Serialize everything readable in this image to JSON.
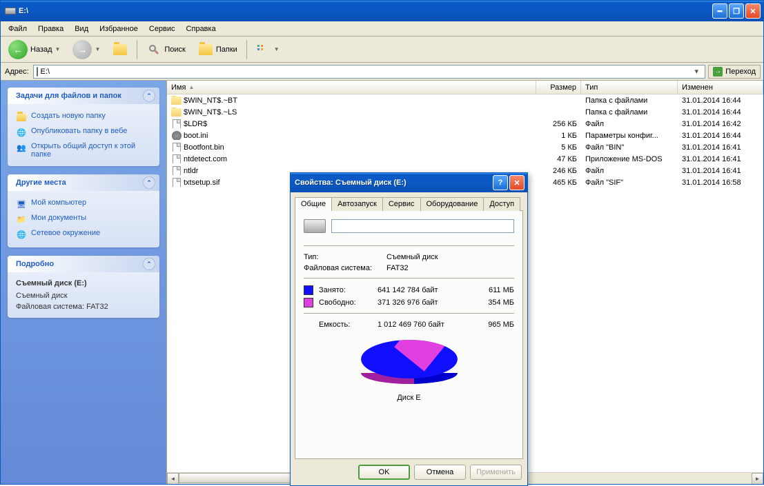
{
  "window": {
    "title": "E:\\",
    "menu": [
      "Файл",
      "Правка",
      "Вид",
      "Избранное",
      "Сервис",
      "Справка"
    ],
    "toolbar": {
      "back": "Назад",
      "search": "Поиск",
      "folders": "Папки"
    },
    "address": {
      "label": "Адрес:",
      "value": "E:\\",
      "go": "Переход"
    }
  },
  "sidebar": {
    "tasks": {
      "title": "Задачи для файлов и папок",
      "items": [
        "Создать новую папку",
        "Опубликовать папку в вебе",
        "Открыть общий доступ к этой папке"
      ]
    },
    "places": {
      "title": "Другие места",
      "items": [
        "Мой компьютер",
        "Мои документы",
        "Сетевое окружение"
      ]
    },
    "details": {
      "title": "Подробно",
      "name": "Съемный диск (E:)",
      "type": "Съемный диск",
      "fs": "Файловая система: FAT32"
    }
  },
  "columns": {
    "name": "Имя",
    "size": "Размер",
    "type": "Тип",
    "modified": "Изменен"
  },
  "files": [
    {
      "icon": "folder",
      "name": "$WIN_NT$.~BT",
      "size": "",
      "type": "Папка с файлами",
      "mod": "31.01.2014 16:44"
    },
    {
      "icon": "folder",
      "name": "$WIN_NT$.~LS",
      "size": "",
      "type": "Папка с файлами",
      "mod": "31.01.2014 16:44"
    },
    {
      "icon": "file",
      "name": "$LDR$",
      "size": "256 КБ",
      "type": "Файл",
      "mod": "31.01.2014 16:42"
    },
    {
      "icon": "gear",
      "name": "boot.ini",
      "size": "1 КБ",
      "type": "Параметры конфиг...",
      "mod": "31.01.2014 16:44"
    },
    {
      "icon": "file",
      "name": "Bootfont.bin",
      "size": "5 КБ",
      "type": "Файл \"BIN\"",
      "mod": "31.01.2014 16:41"
    },
    {
      "icon": "file",
      "name": "ntdetect.com",
      "size": "47 КБ",
      "type": "Приложение MS-DOS",
      "mod": "31.01.2014 16:41"
    },
    {
      "icon": "file",
      "name": "ntldr",
      "size": "246 КБ",
      "type": "Файл",
      "mod": "31.01.2014 16:41"
    },
    {
      "icon": "file",
      "name": "txtsetup.sif",
      "size": "465 КБ",
      "type": "Файл \"SIF\"",
      "mod": "31.01.2014 16:58"
    }
  ],
  "dialog": {
    "title": "Свойства: Съемный диск (E:)",
    "tabs": [
      "Общие",
      "Автозапуск",
      "Сервис",
      "Оборудование",
      "Доступ"
    ],
    "name_value": "",
    "type_label": "Тип:",
    "type_value": "Съемный диск",
    "fs_label": "Файловая система:",
    "fs_value": "FAT32",
    "used_label": "Занято:",
    "used_bytes": "641 142 784 байт",
    "used_mb": "611 МБ",
    "free_label": "Свободно:",
    "free_bytes": "371 326 976 байт",
    "free_mb": "354 МБ",
    "cap_label": "Емкость:",
    "cap_bytes": "1 012 469 760 байт",
    "cap_mb": "965 МБ",
    "chart_label": "Диск E",
    "colors": {
      "used": "#1010ff",
      "free": "#e040e0"
    },
    "buttons": {
      "ok": "OK",
      "cancel": "Отмена",
      "apply": "Применить"
    }
  },
  "chart_data": {
    "type": "pie",
    "title": "Диск E",
    "series": [
      {
        "name": "Занято",
        "value": 641142784,
        "mb": 611,
        "color": "#1010ff"
      },
      {
        "name": "Свободно",
        "value": 371326976,
        "mb": 354,
        "color": "#e040e0"
      }
    ],
    "total": {
      "bytes": 1012469760,
      "mb": 965
    }
  }
}
